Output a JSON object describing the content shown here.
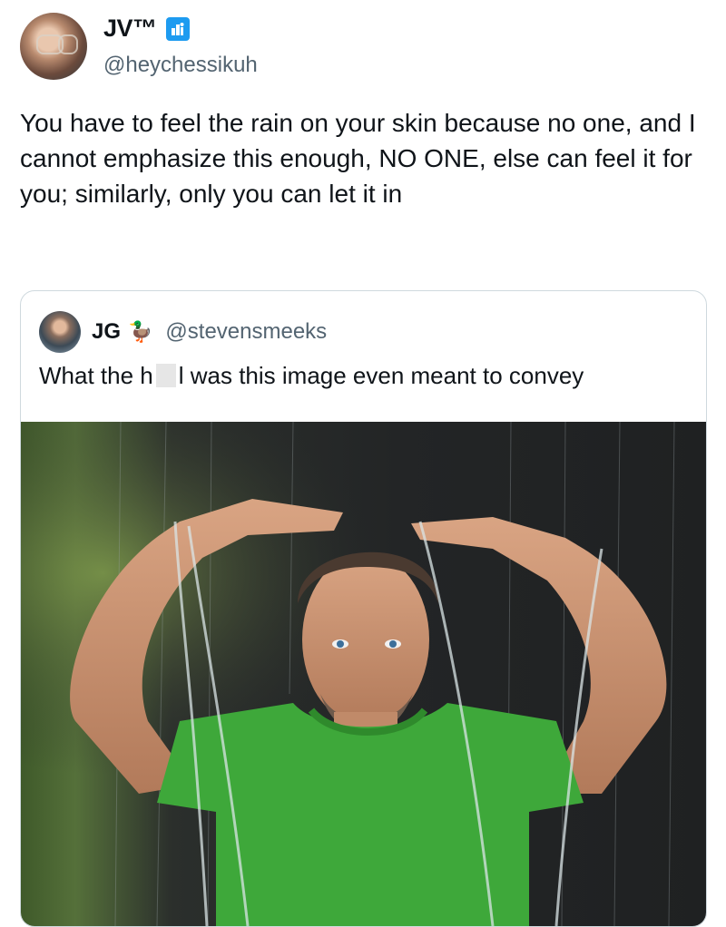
{
  "author": {
    "display_name": "JV™",
    "badge_icon": "affiliate-badge-icon",
    "handle": "@heychessikuh"
  },
  "tweet": {
    "text": "You have to feel the rain on your skin because no one, and I cannot emphasize this enough, NO ONE, else can feel it for you; similarly, only you can let it in"
  },
  "quote": {
    "display_name": "JG",
    "emoji": "🦆",
    "handle": "@stevensmeeks",
    "text_before": "What the h",
    "text_after": "l was this image even meant to convey"
  },
  "colors": {
    "accent": "#1d9bf0",
    "secondary_text": "#536471",
    "border": "#cfd9de",
    "shirt_green": "#3ea83a"
  }
}
